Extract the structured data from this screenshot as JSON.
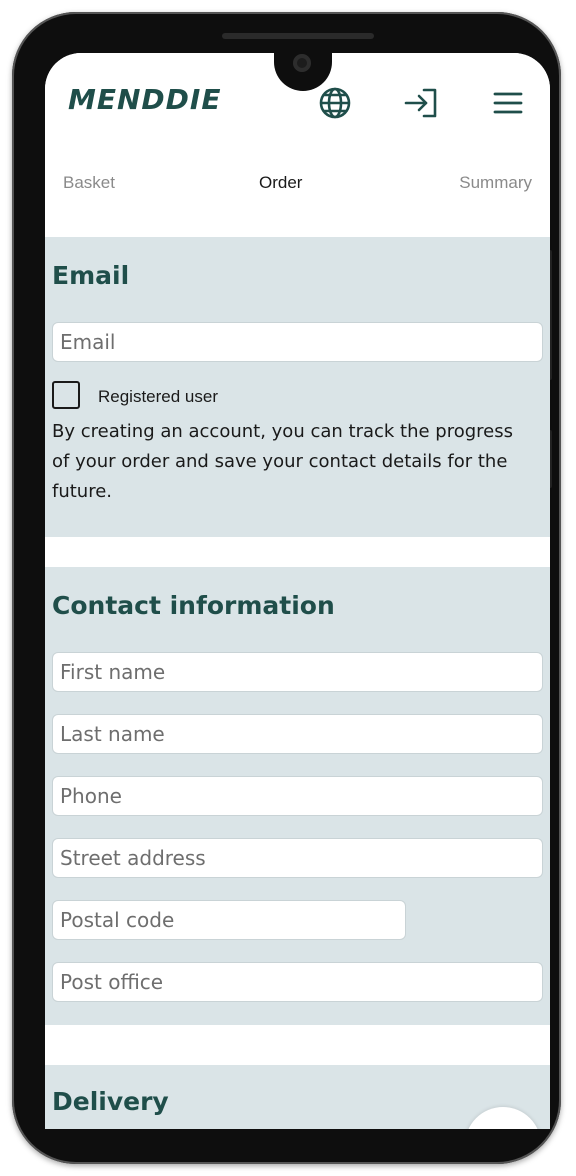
{
  "header": {
    "logo_text": "MENDDIE",
    "icons": {
      "language": "globe-icon",
      "login": "login-icon",
      "menu": "hamburger-menu-icon"
    },
    "brand_color": "#1f4e4a"
  },
  "steps": {
    "basket": "Basket",
    "order": "Order",
    "summary": "Summary",
    "active": "Order"
  },
  "email_section": {
    "title": "Email",
    "email_placeholder": "Email",
    "registered_label": "Registered user",
    "registered_checked": false,
    "info_text": "By creating an account, you can track the progress of your order and save your contact details for the future."
  },
  "contact_section": {
    "title": "Contact information",
    "first_name_placeholder": "First name",
    "last_name_placeholder": "Last name",
    "phone_placeholder": "Phone",
    "street_placeholder": "Street address",
    "postal_placeholder": "Postal code",
    "post_office_placeholder": "Post office"
  },
  "delivery_section": {
    "title": "Delivery"
  },
  "colors": {
    "section_bg": "#dae4e7",
    "heading": "#1f4e4a"
  }
}
